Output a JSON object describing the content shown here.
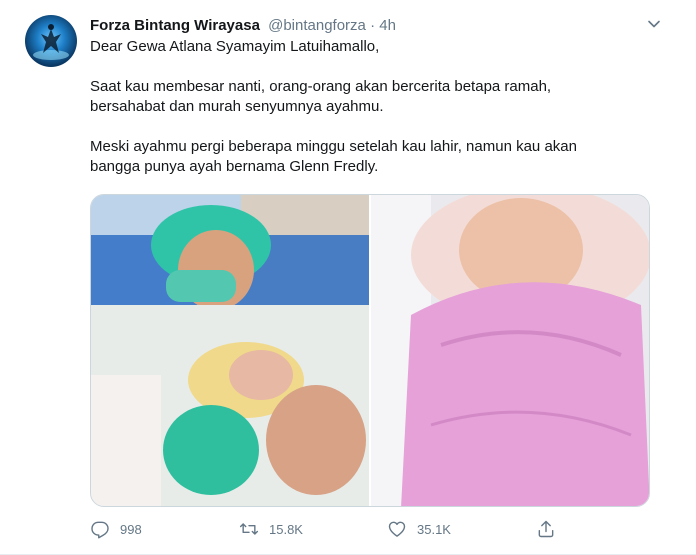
{
  "tweet": {
    "author_name": "Forza Bintang Wirayasa",
    "handle": "@bintangforza",
    "separator": "·",
    "time": "4h",
    "paragraphs": [
      [
        "Dear Gewa Atlana Syamayim Latuihamallo,"
      ],
      [
        "Saat kau membesar nanti, orang-orang akan bercerita betapa ramah,",
        "bersahabat dan murah senyumnya ayahmu."
      ],
      [
        "Meski ayahmu pergi beberapa minggu setelah kau lahir, namun kau akan",
        "bangga punya ayah bernama Glenn Fredly."
      ]
    ],
    "media": [
      {
        "icon": "photo-newborn-with-parents"
      },
      {
        "icon": "photo-newborn-in-pink-blanket"
      }
    ]
  },
  "actions": {
    "reply_count": "998",
    "retweet_count": "15.8K",
    "like_count": "35.1K"
  },
  "icons": {
    "more": "chevron-down-icon",
    "reply": "reply-icon",
    "retweet": "retweet-icon",
    "like": "heart-icon",
    "share": "share-icon"
  },
  "colors": {
    "text": "#14171a",
    "secondary": "#657786",
    "border": "#e6ecf0"
  }
}
